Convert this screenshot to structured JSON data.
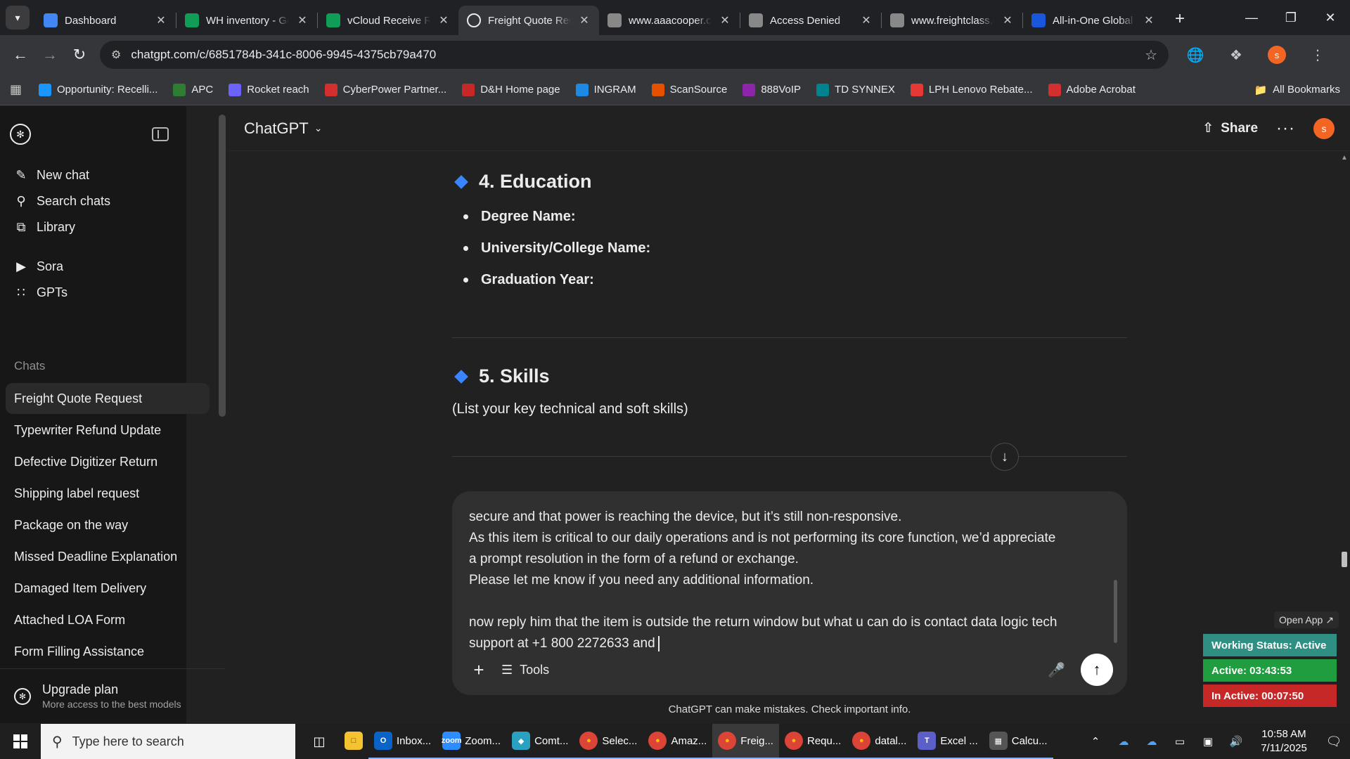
{
  "browser": {
    "tabs": [
      {
        "title": "Dashboard",
        "icon": "dashboard-icon",
        "color": "#4285f4"
      },
      {
        "title": "WH inventory - Google Sheets",
        "icon": "sheets-icon",
        "color": "#0f9d58"
      },
      {
        "title": "vCloud Receive Report",
        "icon": "sheets-icon",
        "color": "#0f9d58"
      },
      {
        "title": "Freight Quote Request",
        "icon": "chatgpt-icon",
        "color": "#ffffff",
        "active": true
      },
      {
        "title": "www.aaacooper.com",
        "icon": "aaacooper-icon",
        "color": "#888888"
      },
      {
        "title": "Access Denied",
        "icon": "globe-icon",
        "color": "#888888"
      },
      {
        "title": "www.freightclass.com",
        "icon": "fcc-icon",
        "color": "#888888"
      },
      {
        "title": "All-in-One Global Tracking",
        "icon": "tracking-icon",
        "color": "#1a56db"
      }
    ],
    "url": "chatgpt.com/c/6851784b-341c-8006-9945-4375cb79a470",
    "bookmarks": [
      {
        "label": "Opportunity: Recelli...",
        "color": "#1b96ff",
        "icon": "cloud-icon"
      },
      {
        "label": "APC",
        "color": "#2e7d32",
        "icon": "apc-icon"
      },
      {
        "label": "Rocket reach",
        "color": "#6c63ff",
        "icon": "rocket-icon"
      },
      {
        "label": "CyberPower Partner...",
        "color": "#d32f2f",
        "icon": "cp-icon"
      },
      {
        "label": "D&H Home page",
        "color": "#c62828",
        "icon": "dh-icon"
      },
      {
        "label": "INGRAM",
        "color": "#1e88e5",
        "icon": "ingram-icon"
      },
      {
        "label": "ScanSource",
        "color": "#e65100",
        "icon": "scansource-icon"
      },
      {
        "label": "888VoIP",
        "color": "#8e24aa",
        "icon": "voip-icon"
      },
      {
        "label": "TD SYNNEX",
        "color": "#00838f",
        "icon": "ec-icon"
      },
      {
        "label": "LPH Lenovo Rebate...",
        "color": "#e53935",
        "icon": "lenovo-icon"
      },
      {
        "label": "Adobe Acrobat",
        "color": "#d32f2f",
        "icon": "acrobat-icon"
      }
    ],
    "all_bookmarks": "All Bookmarks",
    "profile_initial": "s"
  },
  "sidebar": {
    "nav": [
      {
        "label": "New chat",
        "icon": "edit-icon"
      },
      {
        "label": "Search chats",
        "icon": "search-icon"
      },
      {
        "label": "Library",
        "icon": "library-icon"
      },
      {
        "label": "Sora",
        "icon": "play-icon"
      },
      {
        "label": "GPTs",
        "icon": "grid-icon"
      }
    ],
    "chats_heading": "Chats",
    "chats": [
      "Freight Quote Request",
      "Typewriter Refund Update",
      "Defective Digitizer Return",
      "Shipping label request",
      "Package on the way",
      "Missed Deadline Explanation",
      "Damaged Item Delivery",
      "Attached LOA Form",
      "Form Filling Assistance"
    ],
    "upgrade_title": "Upgrade plan",
    "upgrade_sub": "More access to the best models"
  },
  "header": {
    "model": "ChatGPT",
    "share": "Share",
    "avatar": "s"
  },
  "conversation": {
    "section4_title": "4. Education",
    "section4_items": [
      "Degree Name:",
      "University/College Name:",
      "Graduation Year:"
    ],
    "section5_title": "5. Skills",
    "section5_note": "(List your key technical and soft skills)"
  },
  "composer": {
    "lines": [
      "secure and that power is reaching the device, but it’s still non-responsive.",
      "As this item is critical to our daily operations and is not performing its core function, we’d appreciate",
      "a prompt resolution in the form of a refund or exchange.",
      "Please let me know if you need any additional information.",
      "",
      "now reply him that the item is outside the return window but what u can do is contact data logic tech",
      "support at +1 800 2272633 and"
    ],
    "tools": "Tools"
  },
  "disclaimer": "ChatGPT can make mistakes. Check important info.",
  "widget": {
    "open_app": "Open App ↗",
    "working": "Working Status: Active",
    "active": "Active: 03:43:53",
    "inactive": "In Active: 00:07:50",
    "colors": {
      "working": "#2f8f83",
      "active": "#1f9d3f",
      "inactive": "#c62828"
    }
  },
  "taskbar": {
    "search_placeholder": "Type here to search",
    "apps": [
      {
        "label": "Inbox...",
        "color": "#0a64c8",
        "icon": "outlook-icon",
        "text": "O"
      },
      {
        "label": "Zoom...",
        "color": "#2d8cff",
        "icon": "zoom-icon",
        "text": "zoom"
      },
      {
        "label": "Comt...",
        "color": "#2aa1c0",
        "icon": "comtrade-icon",
        "text": "◆"
      },
      {
        "label": "Selec...",
        "color": "#db4437",
        "icon": "chrome-icon",
        "text": "●"
      },
      {
        "label": "Amaz...",
        "color": "#db4437",
        "icon": "chrome-icon",
        "text": "●"
      },
      {
        "label": "Freig...",
        "color": "#db4437",
        "icon": "chrome-icon",
        "text": "●",
        "active": true
      },
      {
        "label": "Requ...",
        "color": "#db4437",
        "icon": "chrome-icon",
        "text": "●"
      },
      {
        "label": "datal...",
        "color": "#db4437",
        "icon": "chrome-icon",
        "text": "●"
      },
      {
        "label": "Excel ...",
        "color": "#5b5fc7",
        "icon": "teams-icon",
        "text": "T"
      },
      {
        "label": "Calcu...",
        "color": "#555555",
        "icon": "calculator-icon",
        "text": "▦"
      }
    ],
    "time": "10:58 AM",
    "date": "7/11/2025"
  }
}
